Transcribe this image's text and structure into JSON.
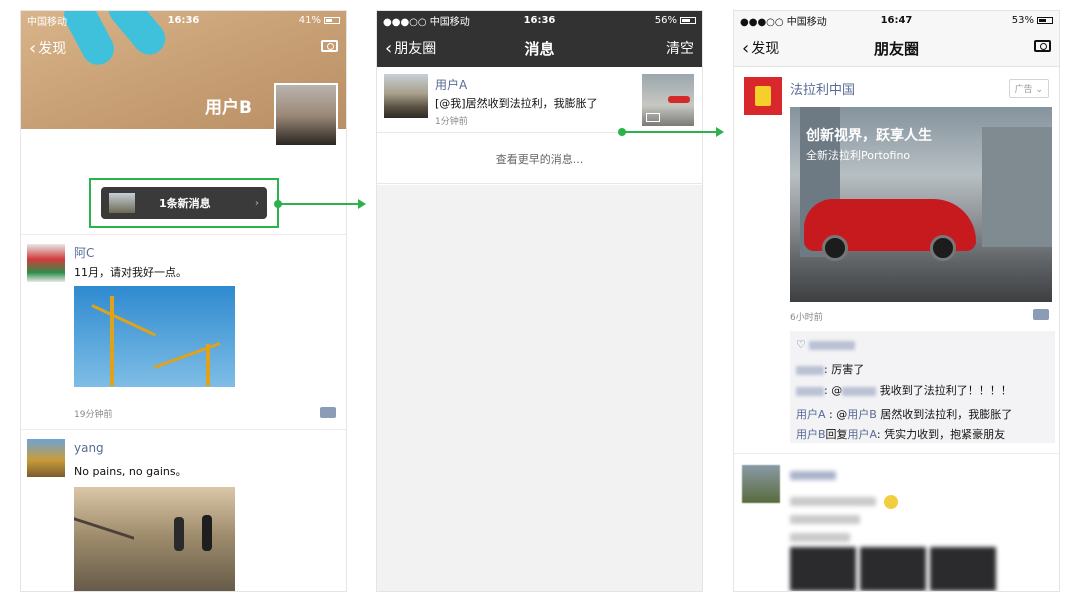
{
  "phone1": {
    "status": {
      "carrier": "中国移动",
      "time": "16:36",
      "battery": "41%"
    },
    "nav": {
      "back": "发现"
    },
    "profile_name": "用户B",
    "new_message": "1条新消息",
    "posts": [
      {
        "name": "阿C",
        "text": "11月，请对我好一点。",
        "time": "19分钟前"
      },
      {
        "name": "yang",
        "text": "No pains, no gains。"
      }
    ]
  },
  "phone2": {
    "status": {
      "carrier": "●●●○○ 中国移动",
      "time": "16:36",
      "battery": "56%"
    },
    "nav": {
      "back": "朋友圈",
      "title": "消息",
      "right": "清空"
    },
    "message": {
      "name": "用户A",
      "text": "[@我]居然收到法拉利，我膨胀了",
      "time": "1分钟前"
    },
    "older": "查看更早的消息..."
  },
  "phone3": {
    "status": {
      "carrier": "●●●○○ 中国移动",
      "time": "16:47",
      "battery": "53%"
    },
    "nav": {
      "back": "发现",
      "title": "朋友圈"
    },
    "ad": {
      "name": "法拉利中国",
      "tag": "广告",
      "headline": "创新视界，跃享人生",
      "subline": "全新法拉利Portofino",
      "time": "6小时前"
    },
    "comments": {
      "c1_text": ": 厉害了",
      "c2_prefix": ": @",
      "c2_text": " 我收到了法拉利了！！！！",
      "c3_user": "用户A",
      "c3_mid": " : @",
      "c3_mention": "用户B",
      "c3_text": " 居然收到法拉利，我膨胀了",
      "c4_user": "用户B",
      "c4_mid": "回复",
      "c4_reply_to": "用户A",
      "c4_text": ": 凭实力收到，抱紧豪朋友"
    }
  },
  "colors": {
    "accent_green": "#2bb24c",
    "link_blue": "#576b95",
    "dark_header": "#323232"
  }
}
